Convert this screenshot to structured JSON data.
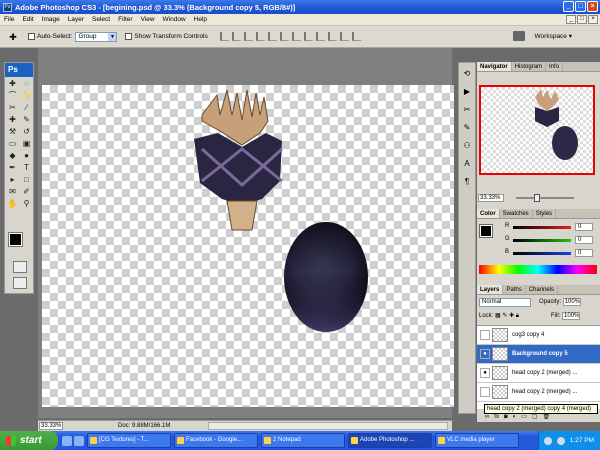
{
  "window": {
    "title": "Adobe Photoshop CS3 - [begining.psd @ 33.3% (Background copy 5, RGB/8#)]",
    "app_badge": "Ps"
  },
  "menu": [
    "File",
    "Edit",
    "Image",
    "Layer",
    "Select",
    "Filter",
    "View",
    "Window",
    "Help"
  ],
  "options": {
    "auto_select_label": "Auto-Select:",
    "auto_select_value": "Group",
    "show_transform_label": "Show Transform Controls",
    "workspace_label": "Workspace ▾"
  },
  "toolbox": {
    "logo": "Ps",
    "tools": [
      "move-tool",
      "marquee-tool",
      "lasso-tool",
      "magic-wand-tool",
      "crop-tool",
      "slice-tool",
      "healing-tool",
      "brush-tool",
      "stamp-tool",
      "history-brush-tool",
      "eraser-tool",
      "gradient-tool",
      "blur-tool",
      "dodge-tool",
      "pen-tool",
      "type-tool",
      "path-select-tool",
      "shape-tool",
      "notes-tool",
      "eyedropper-tool",
      "hand-tool",
      "zoom-tool"
    ],
    "tool_glyphs": [
      "✚",
      "◌",
      "⌒",
      "✨",
      "✂",
      "∕",
      "✚",
      "✎",
      "⚒",
      "↺",
      "▭",
      "▣",
      "◆",
      "●",
      "✒",
      "T",
      "▸",
      "□",
      "✉",
      "✐",
      "✋",
      "⚲"
    ]
  },
  "status": {
    "zoom": "33.33%",
    "doc": "Doc: 9.88M/166.1M"
  },
  "navigator": {
    "tabs": [
      "Navigator",
      "Histogram",
      "Info"
    ],
    "zoom": "33.33%"
  },
  "color_panel": {
    "tabs": [
      "Color",
      "Swatches",
      "Styles"
    ],
    "channels": [
      {
        "label": "R",
        "value": "0",
        "color": "#e02020"
      },
      {
        "label": "G",
        "value": "0",
        "color": "#20c020"
      },
      {
        "label": "B",
        "value": "0",
        "color": "#2040e0"
      }
    ]
  },
  "layers_panel": {
    "tabs": [
      "Layers",
      "Paths",
      "Channels"
    ],
    "blend_mode": "Normal",
    "opacity_label": "Opacity:",
    "opacity": "100%",
    "lock_label": "Lock:",
    "fill_label": "Fill:",
    "fill": "100%",
    "layers": [
      {
        "name": "cog3 copy 4",
        "visible": false,
        "active": false
      },
      {
        "name": "Background copy 5",
        "visible": true,
        "active": true
      },
      {
        "name": "head copy 2 (merged) ...",
        "visible": true,
        "active": false
      },
      {
        "name": "head copy 2 (merged) ...",
        "visible": false,
        "active": false
      }
    ],
    "tooltip": "head copy 2 (merged) copy 4 (merged)"
  },
  "taskbar": {
    "start_label": "start",
    "tasks": [
      {
        "label": "[CG Textures] - T...",
        "active": false
      },
      {
        "label": "Facebook - Google...",
        "active": false
      },
      {
        "label": "2 Notepad",
        "active": false
      },
      {
        "label": "Adobe Photoshop ...",
        "active": true
      },
      {
        "label": "VLC media player",
        "active": false
      }
    ],
    "clock": "1:27 PM"
  },
  "colors": {
    "title_blue": "#1c54d2",
    "active_layer": "#316ac5",
    "nav_frame": "#e00000"
  }
}
